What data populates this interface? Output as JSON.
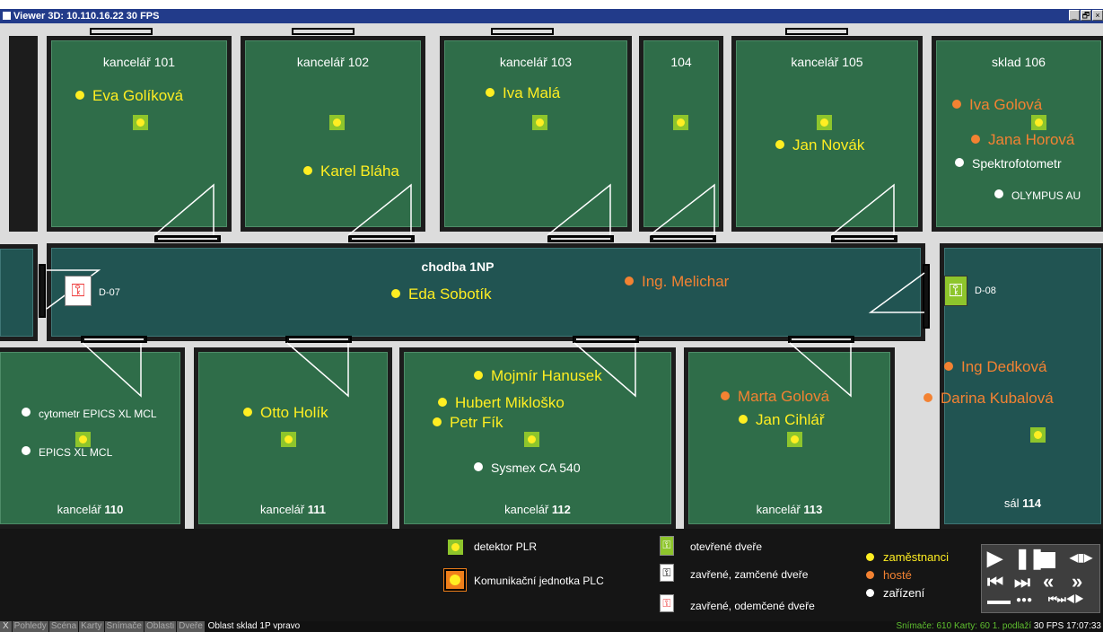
{
  "window": {
    "title": "Viewer 3D: 10.110.16.22  30 FPS",
    "buttons": [
      "_",
      "🗗",
      "×"
    ]
  },
  "rooms_top": [
    {
      "id": "r101",
      "label": "kancelář 101"
    },
    {
      "id": "r102",
      "label": "kancelář 102"
    },
    {
      "id": "r103",
      "label": "kancelář 103"
    },
    {
      "id": "r104",
      "label": "104"
    },
    {
      "id": "r105",
      "label": "kancelář 105"
    },
    {
      "id": "r106",
      "label": "sklad 106"
    }
  ],
  "rooms_bottom": [
    {
      "id": "r110",
      "prefix": "kancelář ",
      "number": "110"
    },
    {
      "id": "r111",
      "prefix": "kancelář ",
      "number": "111"
    },
    {
      "id": "r112",
      "prefix": "kancelář ",
      "number": "112"
    },
    {
      "id": "r113",
      "prefix": "kancelář ",
      "number": "113"
    },
    {
      "id": "r114",
      "prefix": "sál ",
      "number": "114"
    }
  ],
  "corridor": {
    "label": "chodba 1NP"
  },
  "doors": {
    "d07": "D-07",
    "d08": "D-08"
  },
  "people": {
    "eva": "Eva Golíková",
    "karel": "Karel Bláha",
    "iva_mala": "Iva Malá",
    "jan_novak": "Jan  Novák",
    "iva_golova": "Iva Golová",
    "jana_horova": "Jana Horová",
    "eda": "Eda Sobotík",
    "melichar": "Ing. Melichar",
    "otto": "Otto Holík",
    "mojmir": "Mojmír Hanusek",
    "hubert": "Hubert Mikloško",
    "petr": "Petr Fík",
    "marta": "Marta Golová",
    "jan_cihlar": "Jan  Cihlář",
    "dedkova": "Ing Dedková",
    "darina": "Darina Kubalová"
  },
  "devices": {
    "spektro": "Spektrofotometr",
    "olympus": "OLYMPUS AU",
    "cytometr": "cytometr EPICS XL MCL",
    "epics": "EPICS XL MCL",
    "sysmex": "Sysmex CA 540"
  },
  "legend": {
    "detector": "detektor PLR",
    "plc": "Komunikační jednotka PLC",
    "door_open": "otevřené dveře",
    "door_locked": "zavřené, zamčené dveře",
    "door_unlocked": "zavřené, odemčené dveře",
    "employees": "zaměstnanci",
    "guests": "hosté",
    "devices": "zařízení"
  },
  "colors": {
    "employee": "#ffee22",
    "guest": "#f38232",
    "device": "#ffffff",
    "detector": "#8ec52c",
    "room": "#2f6d49",
    "teal_room": "#215452"
  },
  "statusbar": {
    "close": "X",
    "tabs": [
      "Pohledy",
      "Scéna",
      "Karty",
      "Snímače",
      "Oblasti",
      "Dveře"
    ],
    "area": "Oblast sklad 1P vpravo",
    "sensors": "Snímače: 610",
    "cards": "Karty: 60",
    "floor": "1. podlaží",
    "fps": "30 FPS",
    "time": "17:07:33"
  }
}
